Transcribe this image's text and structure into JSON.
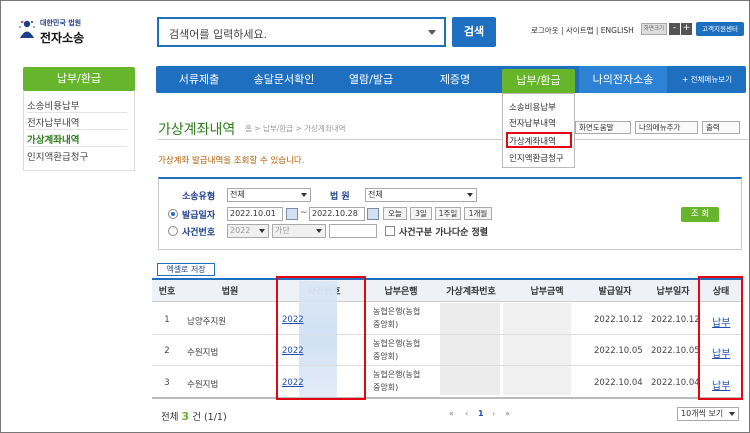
{
  "header": {
    "org": "대한민국 법원",
    "system": "전자소송",
    "search_placeholder": "검색어를 입력하세요.",
    "search_button": "검색",
    "utils": "로그아웃 | 사이트맵 | ENGLISH",
    "font_size": "화면크기",
    "font_minus": "-",
    "font_plus": "+",
    "customer_center": "고객지원센터"
  },
  "left_nav": {
    "title": "납부/환급",
    "items": [
      "소송비용납부",
      "전자납부내역",
      "가상계좌내역",
      "인지액환급청구"
    ]
  },
  "gnb": {
    "items": [
      "서류제출",
      "송달문서확인",
      "열람/발급",
      "제증명",
      "납부/환급",
      "나의전자소송"
    ],
    "all_menu": "+ 전체메뉴보기",
    "dropdown": [
      "소송비용납부",
      "전자납부내역",
      "가상계좌내역",
      "인지액환급청구"
    ]
  },
  "page": {
    "title": "가상계좌내역",
    "breadcrumb": "홈 > 납부/환급 > 가상계좌내역",
    "help": "화면도움말",
    "add_menu": "나의메뉴추가",
    "print": "출력",
    "description": "가상계좌 발급내역을 조회할 수 있습니다."
  },
  "search": {
    "case_type_label": "소송유형",
    "case_type_value": "전체",
    "court_label": "법 원",
    "court_value": "전체",
    "date_label": "발급일자",
    "date_from": "2022.10.01",
    "date_to": "2022.10.28",
    "tilde": "~",
    "quick": [
      "오늘",
      "3일",
      "1주일",
      "1개월"
    ],
    "case_no_label": "사건번호",
    "year_value": "2022",
    "kind_value": "가단",
    "sort_label": "사건구분 가나다순 정렬",
    "query_button": "조 회"
  },
  "table": {
    "excel": "엑셀로 저장",
    "headers": [
      "번호",
      "법원",
      "사건번호",
      "납부은행",
      "가상계좌번호",
      "납부금액",
      "발급일자",
      "납부일자",
      "상태"
    ],
    "rows": [
      {
        "no": "1",
        "court": "남양주지원",
        "case": "2022",
        "bank1": "농협은행(농협",
        "bank2": "중앙회)",
        "issued": "2022.10.12",
        "paid": "2022.10.12",
        "status": "납부"
      },
      {
        "no": "2",
        "court": "수원지법",
        "case": "2022",
        "bank1": "농협은행(농협",
        "bank2": "중앙회)",
        "issued": "2022.10.05",
        "paid": "2022.10.05",
        "status": "납부"
      },
      {
        "no": "3",
        "court": "수원지법",
        "case": "2022",
        "bank1": "농협은행(농협",
        "bank2": "중앙회)",
        "issued": "2022.10.04",
        "paid": "2022.10.04",
        "status": "납부"
      }
    ],
    "total_prefix": "전체",
    "total_count": "3",
    "total_suffix": "건 (1/1)",
    "pager": [
      "«",
      "‹",
      "1",
      "›",
      "»"
    ],
    "page_size": "10개씩 보기"
  },
  "colors": {
    "blue": "#1e6fc0",
    "green": "#66b52a",
    "highlight": "#e30613"
  }
}
